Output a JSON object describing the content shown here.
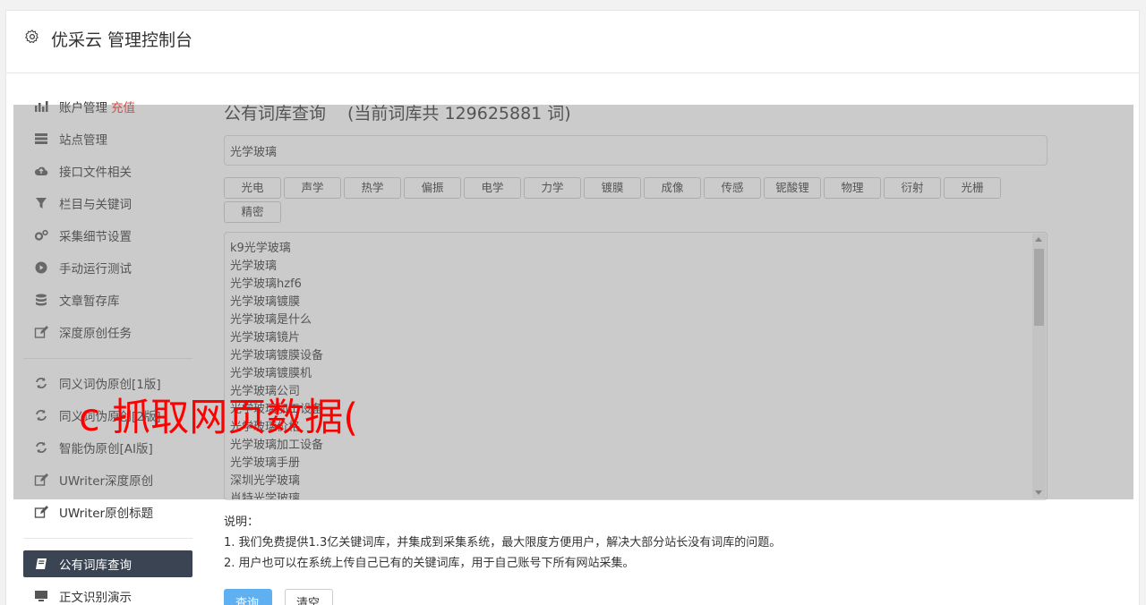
{
  "header": {
    "title": "优采云 管理控制台"
  },
  "sidebar": {
    "items": [
      {
        "label": "账户管理",
        "extra": "充值"
      },
      {
        "label": "站点管理"
      },
      {
        "label": "接口文件相关"
      },
      {
        "label": "栏目与关键词"
      },
      {
        "label": "采集细节设置"
      },
      {
        "label": "手动运行测试"
      },
      {
        "label": "文章暂存库"
      },
      {
        "label": "深度原创任务"
      },
      {
        "label": "同义词伪原创[1版]"
      },
      {
        "label": "同义词伪原创[2版]"
      },
      {
        "label": "智能伪原创[AI版]"
      },
      {
        "label": "UWriter深度原创"
      },
      {
        "label": "UWriter原创标题"
      },
      {
        "label": "公有词库查询"
      },
      {
        "label": "正文识别演示"
      }
    ]
  },
  "main": {
    "title": "公有词库查询",
    "count_text": "(当前词库共 129625881 词)",
    "search_value": "光学玻璃",
    "tags": [
      "光电",
      "声学",
      "热学",
      "偏振",
      "电学",
      "力学",
      "镀膜",
      "成像",
      "传感",
      "铌酸锂",
      "物理",
      "衍射",
      "光栅",
      "精密"
    ],
    "results": [
      "k9光学玻璃",
      "光学玻璃",
      "光学玻璃hzf6",
      "光学玻璃镀膜",
      "光学玻璃是什么",
      "光学玻璃镜片",
      "光学玻璃镀膜设备",
      "光学玻璃镀膜机",
      "光学玻璃公司",
      "光学玻璃加工设备",
      "光学玻璃价格",
      "光学玻璃加工设备",
      "光学玻璃手册",
      "深圳光学玻璃",
      "肖特光学玻璃"
    ],
    "notes": {
      "heading": "说明：",
      "line1": "1. 我们免费提供1.3亿关键词库，并集成到采集系统，最大限度方便用户，解决大部分站长没有词库的问题。",
      "line2": "2. 用户也可以在系统上传自己已有的关键词库，用于自己账号下所有网站采集。"
    },
    "buttons": {
      "query": "查询",
      "clear": "清空"
    }
  },
  "watermark": "c 抓取网页数据(",
  "colors": {
    "sidebar_active": "#3a4453",
    "recharge": "#e53935",
    "primary_button": "#5fb0f0",
    "watermark": "#ff0000"
  }
}
